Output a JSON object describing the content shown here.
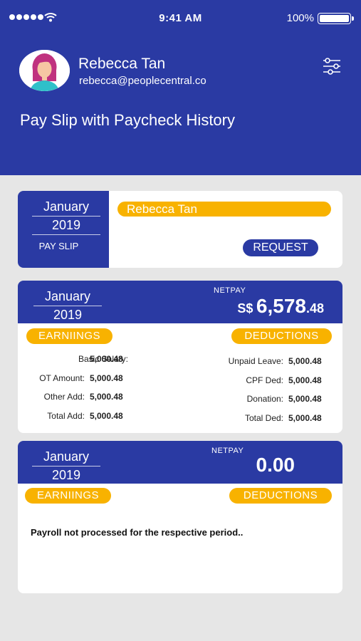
{
  "status_bar": {
    "time": "9:41 AM",
    "battery": "100%"
  },
  "user": {
    "name": "Rebecca Tan",
    "email": "rebecca@peoplecentral.co"
  },
  "page_title": "Pay Slip with Paycheck History",
  "colors": {
    "primary": "#2a3aa3",
    "accent": "#f8b200",
    "background": "#e6e6e6"
  },
  "icons": {
    "filter": "sliders-icon",
    "avatar": "user-avatar"
  },
  "slip_card": {
    "month": "January",
    "year": "2019",
    "label": "PAY SLIP",
    "employee": "Rebecca Tan",
    "request_label": "REQUEST"
  },
  "history": [
    {
      "month": "January",
      "year": "2019",
      "netpay_label": "NETPAY",
      "currency": "S$",
      "amount_int": "6,578",
      "amount_dec": ".48",
      "earnings_label": "EARNIINGS",
      "deductions_label": "DEDUCTIONS",
      "earnings": [
        {
          "label": "Basic Salary:",
          "value": "5,000.48"
        },
        {
          "label": "OT Amount:",
          "value": "5,000.48"
        },
        {
          "label": "Other Add:",
          "value": "5,000.48"
        },
        {
          "label": "Total Add:",
          "value": "5,000.48"
        }
      ],
      "deductions": [
        {
          "label": "Unpaid Leave:",
          "value": "5,000.48"
        },
        {
          "label": "CPF Ded:",
          "value": "5,000.48"
        },
        {
          "label": "Donation:",
          "value": "5,000.48"
        },
        {
          "label": "Total Ded:",
          "value": "5,000.48"
        }
      ]
    },
    {
      "month": "January",
      "year": "2019",
      "netpay_label": "NETPAY",
      "amount": "0.00",
      "earnings_label": "EARNIINGS",
      "deductions_label": "DEDUCTIONS",
      "message": "Payroll not processed for the respective period.."
    }
  ]
}
